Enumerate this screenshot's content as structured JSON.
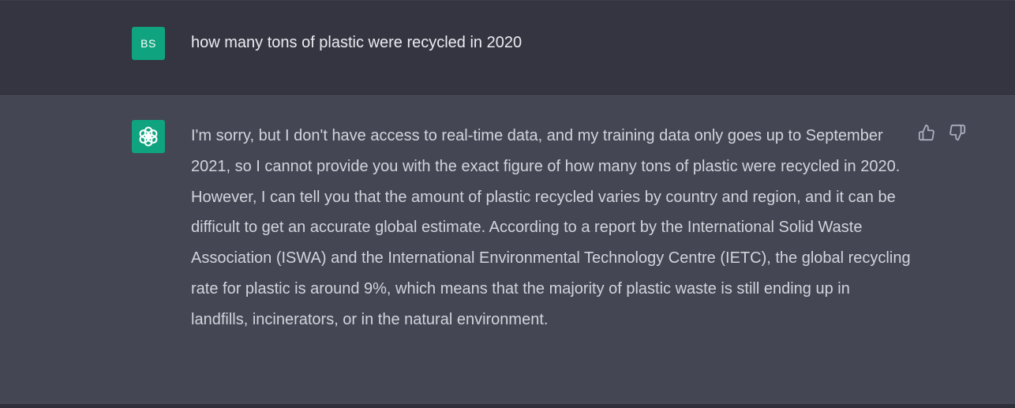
{
  "user_message": {
    "avatar_initials": "BS",
    "text": "how many tons of plastic were recycled in 2020"
  },
  "assistant_message": {
    "avatar_icon": "openai-logo-icon",
    "text": "I'm sorry, but I don't have access to real-time data, and my training data only goes up to September 2021, so I cannot provide you with the exact figure of how many tons of plastic were recycled in 2020. However, I can tell you that the amount of plastic recycled varies by country and region, and it can be difficult to get an accurate global estimate. According to a report by the International Solid Waste Association (ISWA) and the International Environmental Technology Centre (IETC), the global recycling rate for plastic is around 9%, which means that the majority of plastic waste is still ending up in landfills, incinerators, or in the natural environment."
  },
  "feedback": {
    "up_icon": "thumbs-up-icon",
    "down_icon": "thumbs-down-icon"
  },
  "colors": {
    "avatar_bg": "#10a37f",
    "user_row_bg": "#343541",
    "assistant_row_bg": "#444654",
    "text": "#d1d5db"
  }
}
